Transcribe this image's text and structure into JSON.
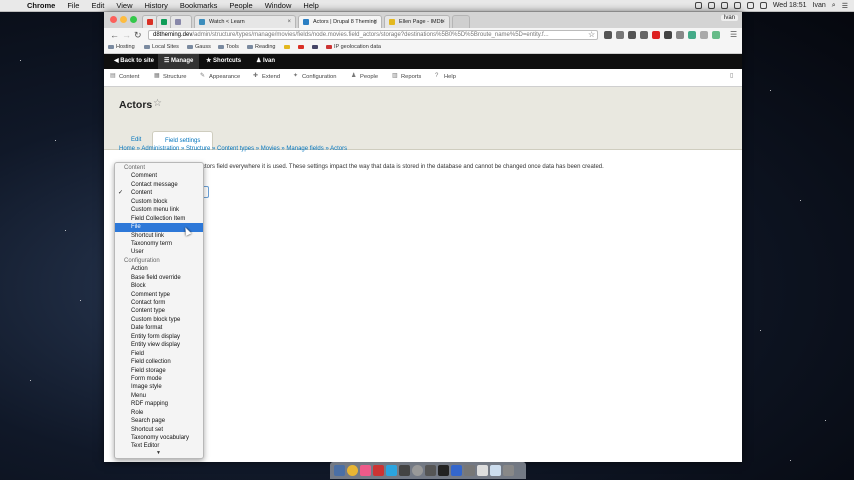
{
  "macbar": {
    "apple": "",
    "menus": [
      "Chrome",
      "File",
      "Edit",
      "View",
      "History",
      "Bookmarks",
      "People",
      "Window",
      "Help"
    ],
    "user": "Ivan",
    "clock": "Wed 18:51"
  },
  "browser": {
    "tabs": [
      {
        "label": "",
        "color": "#d93025"
      },
      {
        "label": "",
        "color": "#0f9d58"
      },
      {
        "label": "Watch < Learn",
        "color": "#3c8dbc"
      },
      {
        "label": "Actors | Drupal 8 Theming",
        "color": "#2b7fc3"
      },
      {
        "label": "Ellen Page - IMDb",
        "color": "#e3b81f"
      }
    ],
    "window_user": "Ivan",
    "url_host": "d8theming.dev",
    "url_path": "/admin/structure/types/manage/movies/fields/node.movies.field_actors/storage?destinations%5B0%5D%5Broute_name%5D=entity.f...",
    "bookmarks": [
      "Hosting",
      "Local Sites",
      "Gauss",
      "Tools",
      "Reading",
      "",
      "",
      "IP geolocation data"
    ]
  },
  "drupal_toolbar": {
    "back": "Back to site",
    "manage": "Manage",
    "shortcuts": "Shortcuts",
    "user": "Ivan"
  },
  "admin_menu": [
    "Content",
    "Structure",
    "Appearance",
    "Extend",
    "Configuration",
    "People",
    "Reports",
    "Help"
  ],
  "page": {
    "title": "Actors",
    "tabs": [
      "Edit",
      "Field settings"
    ],
    "breadcrumb": "Home » Administration » Structure » Content types » Movies » Manage fields » Actors",
    "notice": "ctors field everywhere it is used. These settings impact the way that data is stored in the database and cannot be changed once data has been created."
  },
  "dropdown": {
    "groups": [
      {
        "label": "Content",
        "options": [
          "Comment",
          "Contact message",
          "Content",
          "Custom block",
          "Custom menu link",
          "Field Collection Item",
          "File",
          "Shortcut link",
          "Taxonomy term",
          "User"
        ]
      },
      {
        "label": "Configuration",
        "options": [
          "Action",
          "Base field override",
          "Block",
          "Comment type",
          "Contact form",
          "Content type",
          "Custom block type",
          "Date format",
          "Entity form display",
          "Entity view display",
          "Field",
          "Field collection",
          "Field storage",
          "Form mode",
          "Image style",
          "Menu",
          "RDF mapping",
          "Role",
          "Search page",
          "Shortcut set",
          "Taxonomy vocabulary",
          "Text Editor"
        ]
      }
    ],
    "selected": "Content",
    "highlighted": "File",
    "check": "✓",
    "more_arrow": "▼"
  }
}
